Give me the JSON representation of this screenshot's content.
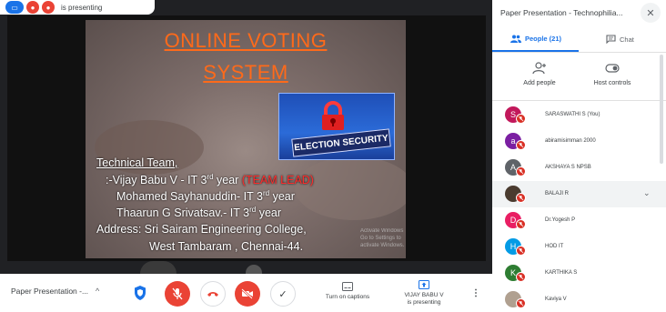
{
  "top_bar": {
    "text": "is presenting"
  },
  "slide": {
    "title_line1": "ONLINE VOTING",
    "title_line2": "SYSTEM",
    "badge_text": "ELECTION SECURITY",
    "team_heading": "Technical Team,",
    "member1_prefix": ":-Vijay Babu V - IT 3",
    "member1_suffix": " year ",
    "member1_role": "(TEAM LEAD)",
    "member2_prefix": "Mohamed Sayhanuddin- IT 3",
    "member2_suffix": " year",
    "member3_prefix": "Thaarun G Srivatsav.- IT 3",
    "member3_suffix": " year",
    "ordinal": "rd",
    "address_line1": "Address: Sri Sairam Engineering College,",
    "address_line2": "West Tambaram , Chennai-44.",
    "watermark_line1": "Activate Windows",
    "watermark_line2": "Go to Settings to activate Windows."
  },
  "controls": {
    "meeting_name": "Paper Presentation -...",
    "captions_label": "Turn on captions",
    "presenting_label_line1": "VIJAY BABU V",
    "presenting_label_line2": "is presenting",
    "colors": {
      "danger": "#ea4335",
      "accent": "#1a73e8"
    }
  },
  "panel": {
    "title": "Paper Presentation - Technophilia...",
    "tabs": {
      "people": "People (21)",
      "chat": "Chat"
    },
    "add_people": "Add people",
    "host_controls": "Host controls",
    "participants": [
      {
        "initial": "S",
        "name": "SARASWATHI S (You)",
        "color": "#c2185b"
      },
      {
        "initial": "a",
        "name": "abiramisimman 2000",
        "color": "#7b1fa2"
      },
      {
        "initial": "A",
        "name": "AKSHAYA S NPSB",
        "color": "#5f6368"
      },
      {
        "initial": "",
        "name": "BALAJI R",
        "color": "#4a3b2f"
      },
      {
        "initial": "D",
        "name": "Dr.Yogesh P",
        "color": "#e91e63"
      },
      {
        "initial": "H",
        "name": "HOD IT",
        "color": "#039be5"
      },
      {
        "initial": "K",
        "name": "KARTHIKA S",
        "color": "#2e7d32"
      },
      {
        "initial": "",
        "name": "Kaviya V",
        "color": "#b0a090"
      }
    ]
  }
}
